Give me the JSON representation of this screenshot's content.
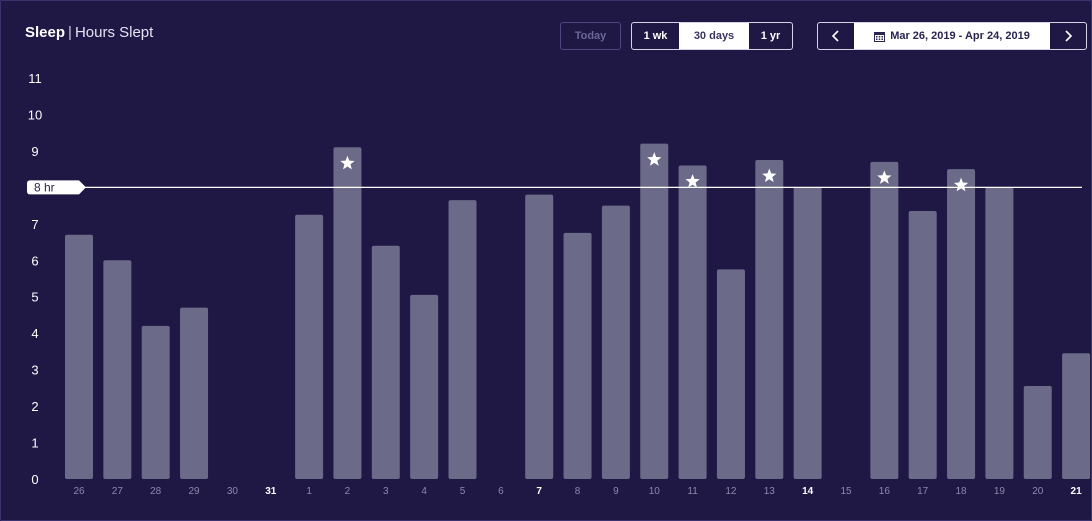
{
  "header": {
    "title_main": "Sleep",
    "title_sep": "|",
    "title_sub": "Hours Slept",
    "today_label": "Today",
    "ranges": [
      {
        "label": "1 wk",
        "active": false
      },
      {
        "label": "30 days",
        "active": true
      },
      {
        "label": "1 yr",
        "active": false
      }
    ],
    "date_range": "Mar 26, 2019 - Apr 24, 2019",
    "prev_icon": "chevron-left-icon",
    "next_icon": "chevron-right-icon",
    "calendar_icon": "calendar-icon"
  },
  "colors": {
    "background": "#1f1845",
    "bar": "#6b6a88",
    "goal_line": "#ffffff",
    "star": "#ffffff"
  },
  "chart_data": {
    "type": "bar",
    "title": "Sleep",
    "subtitle": "Hours Slept",
    "ylim": [
      0,
      11
    ],
    "yticks": [
      0,
      1,
      2,
      3,
      4,
      5,
      6,
      7,
      8,
      9,
      10,
      11
    ],
    "goal": {
      "value": 8,
      "label": "8 hr"
    },
    "categories": [
      "26",
      "27",
      "28",
      "29",
      "30",
      "31",
      "1",
      "2",
      "3",
      "4",
      "5",
      "6",
      "7",
      "8",
      "9",
      "10",
      "11",
      "12",
      "13",
      "14",
      "15",
      "16",
      "17",
      "18",
      "19",
      "20",
      "21"
    ],
    "highlighted_ticks": [
      "31",
      "7",
      "14",
      "21"
    ],
    "values": [
      6.7,
      6.0,
      4.2,
      4.7,
      0,
      0,
      7.25,
      9.1,
      6.4,
      5.05,
      7.65,
      0,
      7.8,
      6.75,
      7.5,
      9.2,
      8.6,
      5.75,
      8.75,
      8.0,
      0,
      8.7,
      7.35,
      8.5,
      8.0,
      2.55,
      3.45
    ],
    "stars": [
      false,
      false,
      false,
      false,
      false,
      false,
      false,
      true,
      false,
      false,
      false,
      false,
      false,
      false,
      false,
      true,
      true,
      false,
      true,
      false,
      false,
      true,
      false,
      true,
      false,
      false,
      false
    ],
    "grid": false,
    "legend": "none"
  }
}
